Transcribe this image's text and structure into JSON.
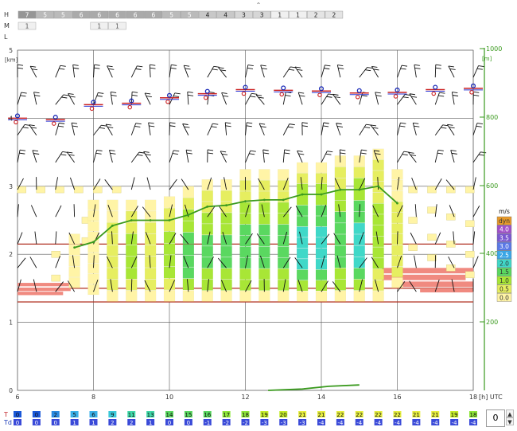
{
  "collapse_glyph": "⌃",
  "cloud_rows": [
    {
      "label": "H",
      "cells": [
        "7",
        "5",
        "5",
        "6",
        "6",
        "6",
        "6",
        "6",
        "5",
        "5",
        "4",
        "4",
        "3",
        "3",
        "1",
        "1",
        "2",
        "2"
      ]
    },
    {
      "label": "M",
      "cells": [
        "1",
        "",
        "",
        "",
        "1",
        "1",
        "",
        "",
        "",
        "",
        "",
        "",
        "",
        "",
        "",
        "",
        "",
        ""
      ]
    },
    {
      "label": "L",
      "cells": []
    }
  ],
  "chart_data": {
    "type": "meteogram",
    "x_unit_label": "[h] UTC",
    "x_ticks": [
      6,
      8,
      10,
      12,
      14,
      16,
      18
    ],
    "xlim": [
      6,
      18
    ],
    "left_axis": {
      "unit_label": "[km]",
      "ticks": [
        0,
        1,
        2,
        3,
        4,
        5
      ],
      "ylim": [
        0,
        5
      ]
    },
    "right_axis": {
      "unit_label": "[m]",
      "ticks": [
        200,
        400,
        600,
        800,
        1000
      ],
      "color": "#3a9a1e"
    },
    "legend": {
      "title": "m/s",
      "items": [
        {
          "label": "dyn",
          "color": "#e89a2a"
        },
        {
          "label": "4.0",
          "color": "#a050c8"
        },
        {
          "label": "3.5",
          "color": "#7a58d0"
        },
        {
          "label": "3.0",
          "color": "#5a78e6"
        },
        {
          "label": "2.5",
          "color": "#3aa6e6"
        },
        {
          "label": "2.0",
          "color": "#40d8c8"
        },
        {
          "label": "1.5",
          "color": "#5ad860"
        },
        {
          "label": "1.0",
          "color": "#a8e636"
        },
        {
          "label": "0.5",
          "color": "#e6ee60"
        },
        {
          "label": "0.0",
          "color": "#fff4a6"
        }
      ]
    },
    "boundary_layer_height": {
      "color": "#3a9a1e",
      "x": [
        7.5,
        8.0,
        8.5,
        9.0,
        9.5,
        10.0,
        10.5,
        11.0,
        11.5,
        12.0,
        12.5,
        13.0,
        13.5,
        14.0,
        14.5,
        15.0,
        15.5,
        16.0
      ],
      "y_km": [
        2.1,
        2.18,
        2.42,
        2.5,
        2.5,
        2.5,
        2.58,
        2.7,
        2.72,
        2.78,
        2.8,
        2.8,
        2.88,
        2.88,
        2.95,
        2.95,
        3.0,
        2.75
      ]
    },
    "precip_line": {
      "color": "#3a9a1e",
      "x": [
        12.6,
        13.5,
        14.2,
        15.0
      ],
      "y_km": [
        0.0,
        0.02,
        0.06,
        0.08
      ]
    },
    "lcl_markers": {
      "x": [
        6,
        7,
        8,
        9,
        10,
        11,
        12,
        13,
        14,
        15,
        16,
        17,
        18
      ],
      "y_km": [
        4.0,
        3.98,
        4.2,
        4.22,
        4.3,
        4.36,
        4.42,
        4.41,
        4.4,
        4.37,
        4.38,
        4.42,
        4.44
      ]
    },
    "inversions_km": [
      1.3,
      1.5,
      2.15
    ],
    "thermal_columns": [
      {
        "x": 7.5,
        "bottom": 1.5,
        "top": 2.3,
        "max_color": "#fff4a6"
      },
      {
        "x": 8.0,
        "bottom": 1.4,
        "top": 2.8,
        "max_color": "#fff4a6"
      },
      {
        "x": 8.5,
        "bottom": 1.3,
        "top": 2.8,
        "max_color": "#e6ee60"
      },
      {
        "x": 9.0,
        "bottom": 1.3,
        "top": 2.8,
        "max_color": "#a8e636"
      },
      {
        "x": 9.5,
        "bottom": 1.3,
        "top": 2.8,
        "max_color": "#e6ee60"
      },
      {
        "x": 10.0,
        "bottom": 1.3,
        "top": 2.85,
        "max_color": "#a8e636"
      },
      {
        "x": 10.5,
        "bottom": 1.3,
        "top": 3.0,
        "max_color": "#5ad860"
      },
      {
        "x": 11.0,
        "bottom": 1.3,
        "top": 3.1,
        "max_color": "#5ad860"
      },
      {
        "x": 11.5,
        "bottom": 1.3,
        "top": 3.1,
        "max_color": "#5ad860"
      },
      {
        "x": 12.0,
        "bottom": 1.3,
        "top": 3.25,
        "max_color": "#5ad860"
      },
      {
        "x": 12.5,
        "bottom": 1.3,
        "top": 3.25,
        "max_color": "#5ad860"
      },
      {
        "x": 13.0,
        "bottom": 1.3,
        "top": 3.25,
        "max_color": "#5ad860"
      },
      {
        "x": 13.5,
        "bottom": 1.3,
        "top": 3.35,
        "max_color": "#40d8c8"
      },
      {
        "x": 14.0,
        "bottom": 1.3,
        "top": 3.35,
        "max_color": "#40d8c8"
      },
      {
        "x": 14.5,
        "bottom": 1.3,
        "top": 3.45,
        "max_color": "#5ad860"
      },
      {
        "x": 15.0,
        "bottom": 1.3,
        "top": 3.45,
        "max_color": "#40d8c8"
      },
      {
        "x": 15.5,
        "bottom": 1.3,
        "top": 3.55,
        "max_color": "#a8e636"
      },
      {
        "x": 16.0,
        "bottom": 1.5,
        "top": 3.25,
        "max_color": "#e6ee60"
      }
    ],
    "wind_barb_times": [
      6,
      6.5,
      7,
      7.5,
      8,
      8.5,
      9,
      9.5,
      10,
      10.5,
      11,
      11.5,
      12,
      12.5,
      13,
      13.5,
      14,
      14.5,
      15,
      15.5,
      16,
      16.5,
      17,
      17.5,
      18
    ]
  },
  "temps": {
    "T_label": "T",
    "Td_label": "Td",
    "T": [
      "0",
      "0",
      "2",
      "5",
      "6",
      "9",
      "11",
      "13",
      "14",
      "15",
      "16",
      "17",
      "18",
      "19",
      "20",
      "21",
      "21",
      "22",
      "22",
      "22",
      "22",
      "21",
      "21",
      "19",
      "18"
    ],
    "Td": [
      "0",
      "0",
      "0",
      "1",
      "1",
      "2",
      "2",
      "1",
      "0",
      "0",
      "-1",
      "-2",
      "-2",
      "-3",
      "-3",
      "-3",
      "-4",
      "-4",
      "-4",
      "-4",
      "-4",
      "-4",
      "-4",
      "-4",
      "-4"
    ]
  },
  "stepper_value": "0",
  "colors": {
    "grid": "#555555",
    "inversion": "#b03020",
    "lcl_line": "#cc2222",
    "lcl_dot": "#1a2ab8",
    "axis_green": "#3a9a1e",
    "sky": "#1a58d8"
  }
}
